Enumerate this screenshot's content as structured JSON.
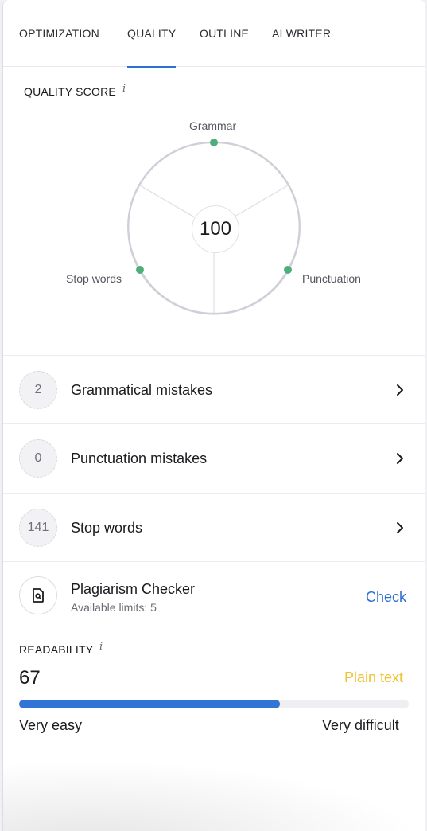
{
  "tabs": [
    {
      "label": "OPTIMIZATION",
      "active": false
    },
    {
      "label": "QUALITY",
      "active": true
    },
    {
      "label": "OUTLINE",
      "active": false
    },
    {
      "label": "AI WRITER",
      "active": false
    }
  ],
  "quality": {
    "title": "QUALITY SCORE",
    "info": "i",
    "score": "100",
    "axes": [
      "Grammar",
      "Punctuation",
      "Stop words"
    ],
    "point_color": "#4caf7a"
  },
  "items": [
    {
      "count": "2",
      "label": "Grammatical mistakes"
    },
    {
      "count": "0",
      "label": "Punctuation mistakes"
    },
    {
      "count": "141",
      "label": "Stop words"
    }
  ],
  "plagiarism": {
    "title": "Plagiarism Checker",
    "subtitle": "Available limits: 5",
    "action": "Check",
    "icon": "document-search-icon"
  },
  "readability": {
    "title": "READABILITY",
    "info": "i",
    "score": "67",
    "level": 0.67,
    "text_type": "Plain text",
    "scale_min": "Very easy",
    "scale_max": "Very difficult",
    "accent": "#3375d6",
    "type_color": "#f1c232"
  }
}
